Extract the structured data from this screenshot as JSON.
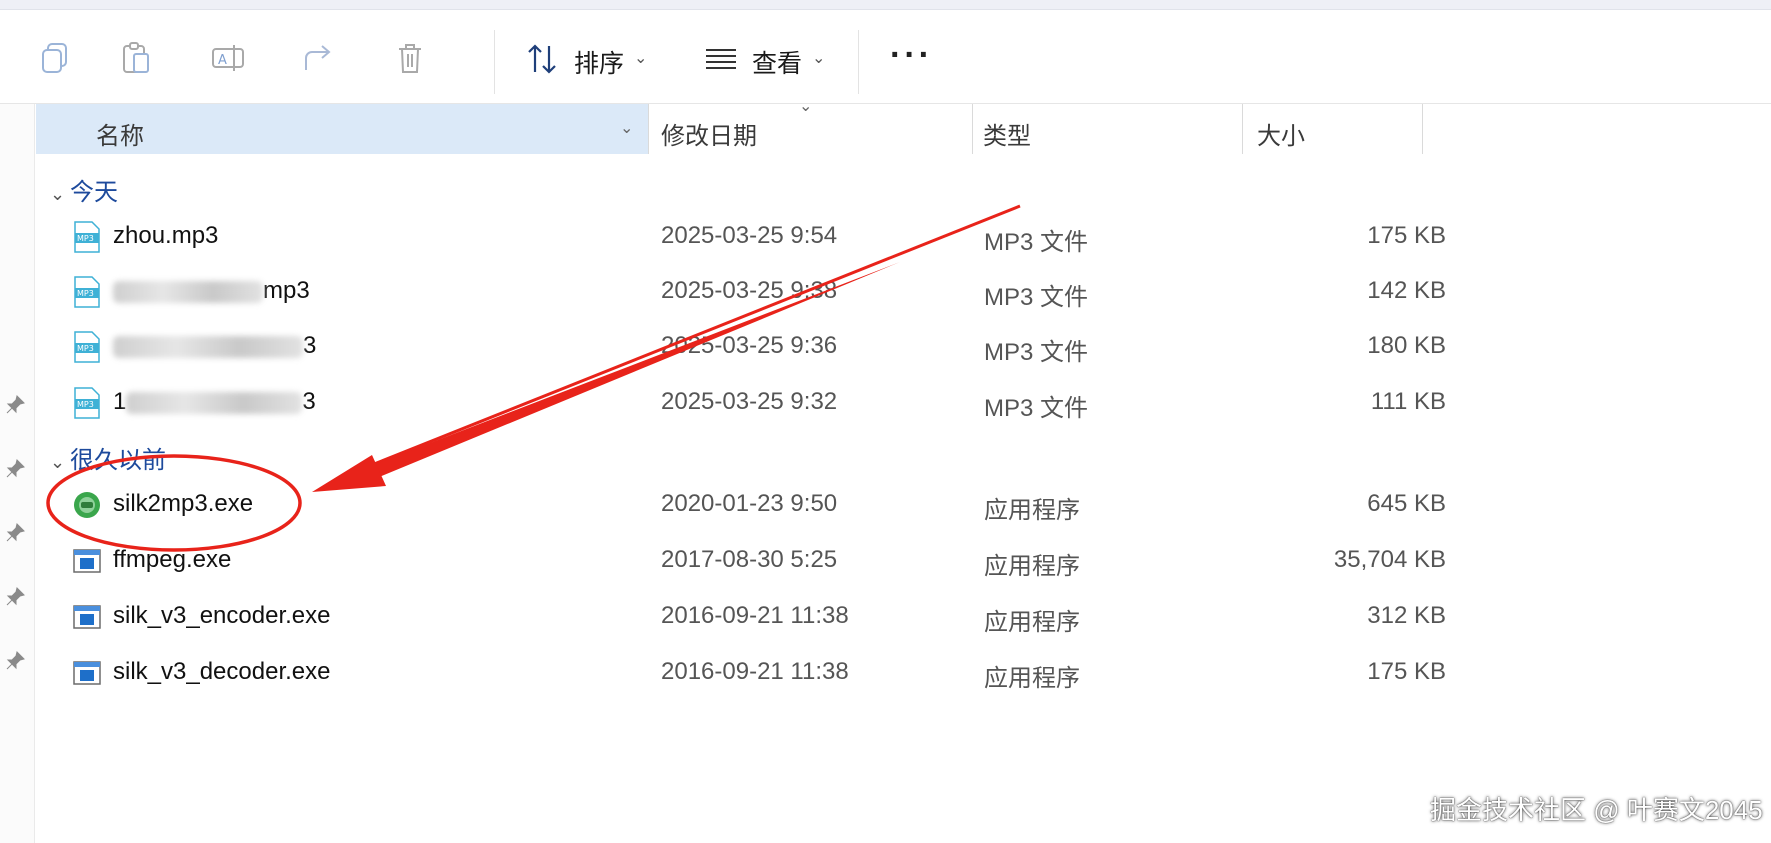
{
  "toolbar": {
    "sort_label": "排序",
    "view_label": "查看",
    "more_label": "···"
  },
  "columns": {
    "name": "名称",
    "modified": "修改日期",
    "type": "类型",
    "size": "大小"
  },
  "groups": [
    {
      "label": "今天",
      "files": [
        {
          "name": "zhou.mp3",
          "date": "2025-03-25 9:54",
          "type": "MP3 文件",
          "size": "175 KB",
          "icon": "mp3-file-icon"
        },
        {
          "name_prefix": "",
          "name_suffix": "mp3",
          "date": "2025-03-25 9:38",
          "type": "MP3 文件",
          "size": "142 KB",
          "icon": "mp3-file-icon"
        },
        {
          "name_prefix": "",
          "name_suffix": "3",
          "date": "2025-03-25 9:36",
          "type": "MP3 文件",
          "size": "180 KB",
          "icon": "mp3-file-icon"
        },
        {
          "name_prefix": "1",
          "name_suffix": "3",
          "date": "2025-03-25 9:32",
          "type": "MP3 文件",
          "size": "111 KB",
          "icon": "mp3-file-icon"
        }
      ]
    },
    {
      "label": "很久以前",
      "files": [
        {
          "name": "silk2mp3.exe",
          "date": "2020-01-23 9:50",
          "type": "应用程序",
          "size": "645 KB",
          "icon": "silk2mp3-app-icon"
        },
        {
          "name": "ffmpeg.exe",
          "date": "2017-08-30 5:25",
          "type": "应用程序",
          "size": "35,704 KB",
          "icon": "exe-app-icon"
        },
        {
          "name": "silk_v3_encoder.exe",
          "date": "2016-09-21 11:38",
          "type": "应用程序",
          "size": "312 KB",
          "icon": "exe-app-icon"
        },
        {
          "name": "silk_v3_decoder.exe",
          "date": "2016-09-21 11:38",
          "type": "应用程序",
          "size": "175 KB",
          "icon": "exe-app-icon"
        }
      ]
    }
  ],
  "watermark": "掘金技术社区 @ 叶赛文2045",
  "colors": {
    "accent_selected_header": "#dbe9f8",
    "group_label": "#1d4a9c",
    "annotation_red": "#e8231a",
    "mp3_icon": "#3fb1d6",
    "silk_icon": "#3aa64c",
    "exe_icon": "#1e6fc9"
  }
}
